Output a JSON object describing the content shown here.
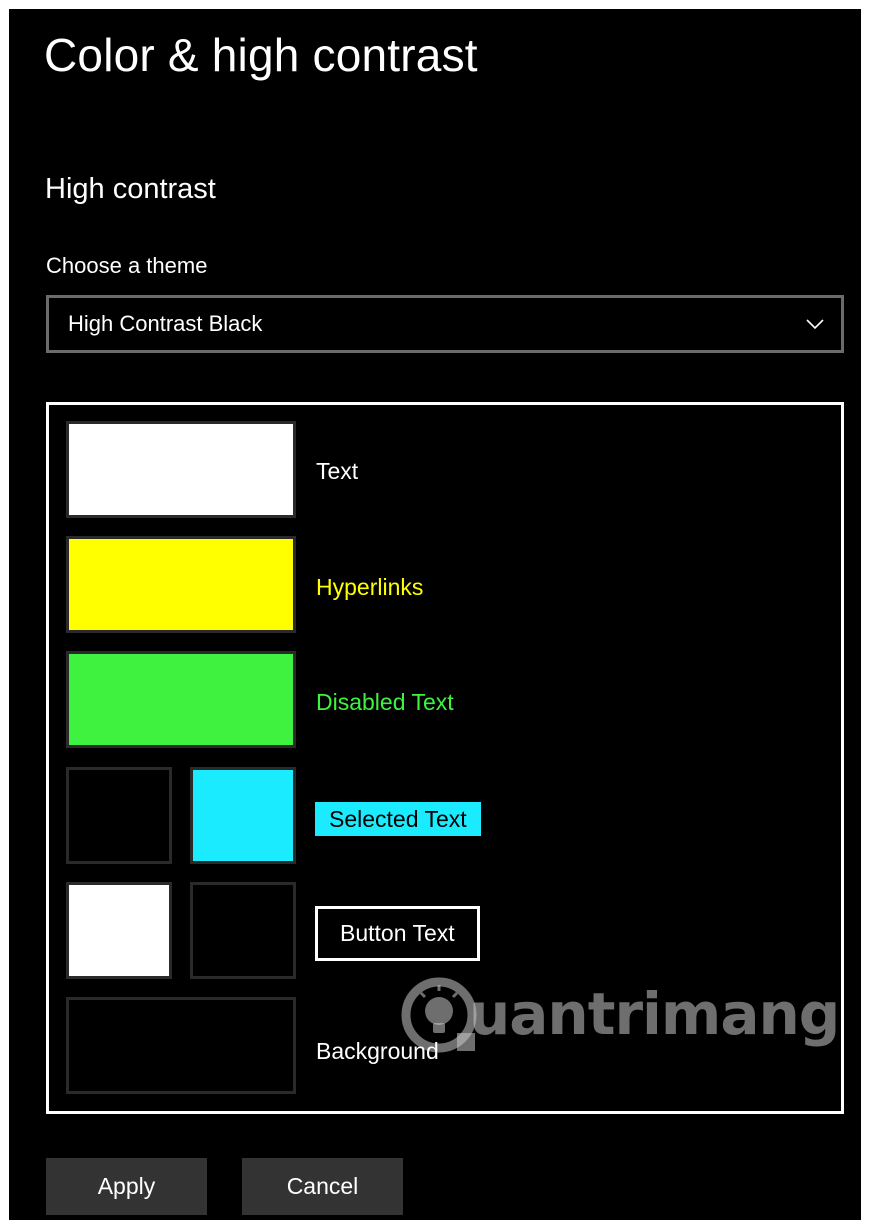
{
  "page": {
    "title": "Color & high contrast"
  },
  "high_contrast": {
    "section_title": "High contrast",
    "theme_label": "Choose a theme",
    "theme_selected": "High Contrast Black",
    "dropdown_icon": "chevron-down-icon"
  },
  "preview": {
    "rows": [
      {
        "label": "Text",
        "label_color": "#ffffff",
        "swatch_colors": [
          "#ffffff"
        ]
      },
      {
        "label": "Hyperlinks",
        "label_color": "#ffff00",
        "swatch_colors": [
          "#ffff00"
        ]
      },
      {
        "label": "Disabled Text",
        "label_color": "#3ff23f",
        "swatch_colors": [
          "#3ff23f"
        ]
      },
      {
        "label": "Selected Text",
        "label_color": "#000000",
        "label_background": "#1aebff",
        "swatch_colors": [
          "#000000",
          "#1aebff"
        ]
      },
      {
        "label": "Button Text",
        "label_color": "#ffffff",
        "label_border": "#ffffff",
        "swatch_colors": [
          "#ffffff",
          "#000000"
        ]
      },
      {
        "label": "Background",
        "label_color": "#ffffff",
        "swatch_colors": [
          "#000000"
        ]
      }
    ]
  },
  "watermark": {
    "text": "uantrimang",
    "icon": "lightbulb-logo-icon"
  },
  "actions": {
    "apply_label": "Apply",
    "cancel_label": "Cancel"
  },
  "colors": {
    "background": "#000000",
    "button_background": "#333333",
    "dropdown_border": "#6b6b6b",
    "swatch_border": "#2a2a2a"
  }
}
